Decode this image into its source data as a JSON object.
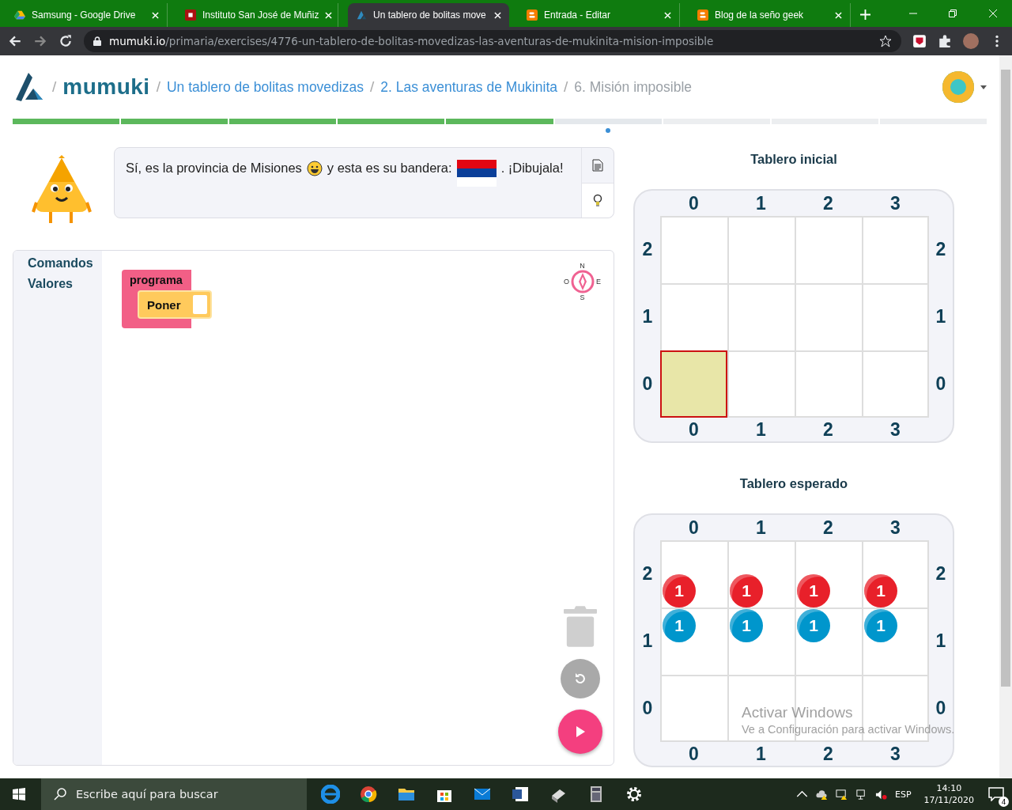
{
  "browser": {
    "tabs": [
      {
        "title": "Samsung - Google Drive",
        "kind": "drive",
        "selected": false
      },
      {
        "title": "Instituto San José de Muñiz",
        "kind": "school",
        "selected": false
      },
      {
        "title": "Un tablero de bolitas move",
        "kind": "mumuki",
        "selected": true
      },
      {
        "title": "Entrada - Editar",
        "kind": "blogger",
        "selected": false
      },
      {
        "title": "Blog de la seño geek",
        "kind": "blogger",
        "selected": false
      }
    ],
    "address": {
      "domain": "mumuki.io",
      "path": "/primaria/exercises/4776-un-tablero-de-bolitas-movedizas-las-aventuras-de-mukinita-mision-imposible"
    }
  },
  "header": {
    "logo_separator": "/",
    "logo": "mumuki",
    "breadcrumb": [
      {
        "separator": "/",
        "label": "Un tablero de bolitas movedizas",
        "current": false
      },
      {
        "separator": "/",
        "label": "2. Las aventuras de Mukinita",
        "current": false
      },
      {
        "separator": "/",
        "label": "6. Misión imposible",
        "current": true
      }
    ]
  },
  "progress": [
    {
      "done": true,
      "current": false
    },
    {
      "done": true,
      "current": false
    },
    {
      "done": true,
      "current": false
    },
    {
      "done": true,
      "current": false
    },
    {
      "done": true,
      "current": false
    },
    {
      "done": false,
      "current": true
    },
    {
      "done": false,
      "current": false
    },
    {
      "done": false,
      "current": false
    },
    {
      "done": false,
      "current": false
    }
  ],
  "message": {
    "before": "Sí, es la provincia de Misiones",
    "middle": "y esta es su bandera:",
    "after": ". ¡Dibujala!"
  },
  "workspace": {
    "sidebar": [
      "Comandos",
      "Valores"
    ],
    "program_block": "programa",
    "command_block": "Poner",
    "compass": {
      "north": "N",
      "west": "O",
      "east": "E",
      "south": "S"
    }
  },
  "boards": [
    {
      "title": "Tablero inicial",
      "top_columns": [
        "0",
        "1",
        "2",
        "3"
      ],
      "bottom_columns": [
        "0",
        "1",
        "2",
        "3"
      ],
      "rows": [
        {
          "left_label": "2",
          "right_label": "2",
          "cells": [
            {
              "selected": false
            },
            {
              "selected": false
            },
            {
              "selected": false
            },
            {
              "selected": false
            }
          ]
        },
        {
          "left_label": "1",
          "right_label": "1",
          "cells": [
            {
              "selected": false
            },
            {
              "selected": false
            },
            {
              "selected": false
            },
            {
              "selected": false
            }
          ]
        },
        {
          "left_label": "0",
          "right_label": "0",
          "cells": [
            {
              "selected": true
            },
            {
              "selected": false
            },
            {
              "selected": false
            },
            {
              "selected": false
            }
          ]
        }
      ]
    },
    {
      "title": "Tablero esperado",
      "top_columns": [
        "0",
        "1",
        "2",
        "3"
      ],
      "bottom_columns": [
        "0",
        "1",
        "2",
        "3"
      ],
      "rows": [
        {
          "left_label": "2",
          "right_label": "2",
          "cells": [
            {
              "selected": false,
              "balls": [
                {
                  "kind": "red",
                  "color": "#e8202a",
                  "count": "1"
                }
              ]
            },
            {
              "selected": false,
              "balls": [
                {
                  "kind": "red",
                  "color": "#e8202a",
                  "count": "1"
                }
              ]
            },
            {
              "selected": false,
              "balls": [
                {
                  "kind": "red",
                  "color": "#e8202a",
                  "count": "1"
                }
              ]
            },
            {
              "selected": false,
              "balls": [
                {
                  "kind": "red",
                  "color": "#e8202a",
                  "count": "1"
                }
              ]
            }
          ]
        },
        {
          "left_label": "1",
          "right_label": "1",
          "cells": [
            {
              "selected": false,
              "balls": [
                {
                  "kind": "blue",
                  "color": "#0096cc",
                  "count": "1"
                }
              ]
            },
            {
              "selected": false,
              "balls": [
                {
                  "kind": "blue",
                  "color": "#0096cc",
                  "count": "1"
                }
              ]
            },
            {
              "selected": false,
              "balls": [
                {
                  "kind": "blue",
                  "color": "#0096cc",
                  "count": "1"
                }
              ]
            },
            {
              "selected": false,
              "balls": [
                {
                  "kind": "blue",
                  "color": "#0096cc",
                  "count": "1"
                }
              ]
            }
          ]
        },
        {
          "left_label": "0",
          "right_label": "0",
          "cells": [
            {
              "selected": false
            },
            {
              "selected": false
            },
            {
              "selected": false
            },
            {
              "selected": false
            }
          ]
        }
      ]
    }
  ],
  "watermark": {
    "title": "Activar Windows",
    "subtitle": "Ve a Configuración para activar Windows."
  },
  "taskbar": {
    "search_placeholder": "Escribe aquí para buscar",
    "language": "ESP",
    "time": "14:10",
    "date": "17/11/2020",
    "notifications": "4"
  }
}
